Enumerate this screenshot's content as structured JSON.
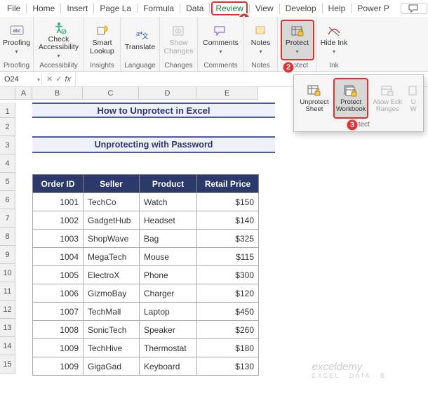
{
  "tabs": {
    "file": "File",
    "home": "Home",
    "insert": "Insert",
    "pagelayout": "Page La",
    "formula": "Formula",
    "data": "Data",
    "review": "Review",
    "view": "View",
    "develop": "Develop",
    "help": "Help",
    "powerp": "Power P"
  },
  "ribbon": {
    "proofing": {
      "label": "Proofing",
      "btn": "Proofing"
    },
    "accessibility": {
      "label": "Accessibility",
      "btn": "Check Accessibility"
    },
    "insights": {
      "label": "Insights",
      "btn": "Smart Lookup"
    },
    "language": {
      "label": "Language",
      "btn": "Translate"
    },
    "changes": {
      "label": "Changes",
      "btn": "Show Changes"
    },
    "comments": {
      "label": "Comments",
      "btn": "Comments"
    },
    "notes_group": {
      "label": "Notes",
      "btn": "Notes"
    },
    "protect_group": {
      "label": "Protect",
      "btn": "Protect"
    },
    "ink": {
      "label": "Ink",
      "btn": "Hide Ink"
    }
  },
  "popup": {
    "unprotect_sheet": "Unprotect Sheet",
    "protect_workbook": "Protect Workbook",
    "allow_edit": "Allow Edit Ranges",
    "unshare": "U W",
    "group_label": "Protect"
  },
  "badges": {
    "b1": "1",
    "b2": "2",
    "b3": "3"
  },
  "namebox": {
    "ref": "O24",
    "fx": "fx"
  },
  "columns": [
    "A",
    "B",
    "C",
    "D",
    "E"
  ],
  "rows": [
    "1",
    "2",
    "3",
    "4",
    "5",
    "6",
    "7",
    "8",
    "9",
    "10",
    "11",
    "12",
    "13",
    "14",
    "15"
  ],
  "banners": {
    "title": "How to Unprotect in Excel",
    "subtitle": "Unprotecting with Password"
  },
  "table": {
    "headers": [
      "Order ID",
      "Seller",
      "Product",
      "Retail Price"
    ],
    "rows": [
      {
        "id": "1001",
        "seller": "TechCo",
        "product": "Watch",
        "price": "$150"
      },
      {
        "id": "1002",
        "seller": "GadgetHub",
        "product": "Headset",
        "price": "$140"
      },
      {
        "id": "1003",
        "seller": "ShopWave",
        "product": "Bag",
        "price": "$325"
      },
      {
        "id": "1004",
        "seller": "MegaTech",
        "product": "Mouse",
        "price": "$115"
      },
      {
        "id": "1005",
        "seller": "ElectroX",
        "product": "Phone",
        "price": "$300"
      },
      {
        "id": "1006",
        "seller": "GizmoBay",
        "product": "Charger",
        "price": "$120"
      },
      {
        "id": "1007",
        "seller": "TechMall",
        "product": "Laptop",
        "price": "$450"
      },
      {
        "id": "1008",
        "seller": "SonicTech",
        "product": "Speaker",
        "price": "$260"
      },
      {
        "id": "1009",
        "seller": "TechHive",
        "product": "Thermostat",
        "price": "$180"
      },
      {
        "id": "1009",
        "seller": "GigaGad",
        "product": "Keyboard",
        "price": "$130"
      }
    ]
  },
  "watermark": {
    "main": "exceldemy",
    "sub": "EXCEL · DATA · B"
  },
  "col_widths": {
    "A": 24,
    "B": 72,
    "C": 80,
    "D": 82,
    "E": 88
  }
}
